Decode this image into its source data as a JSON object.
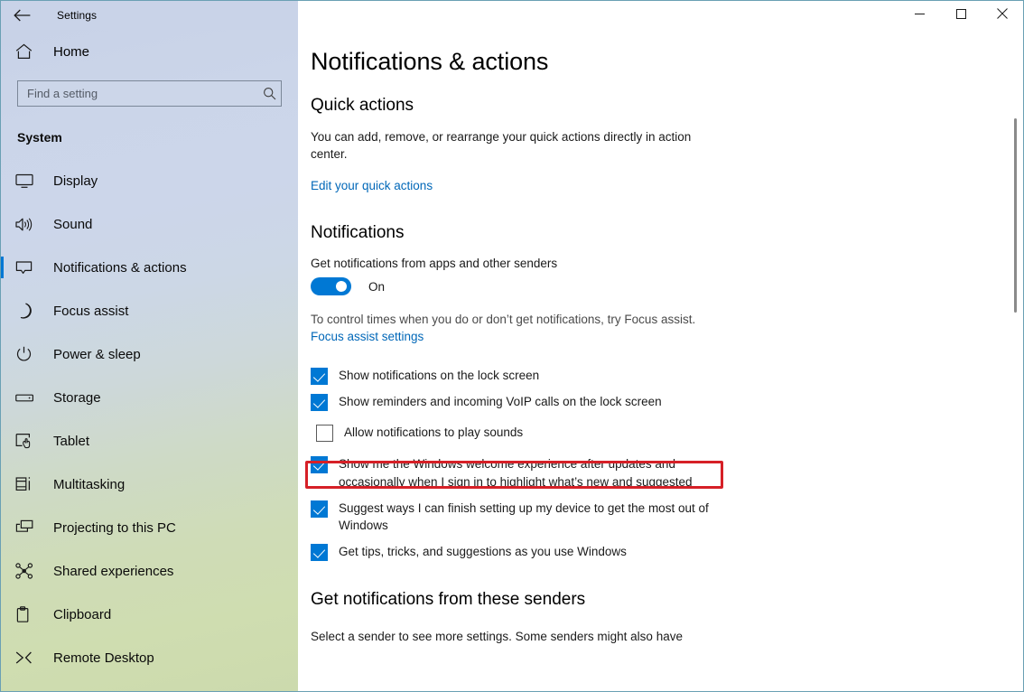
{
  "window": {
    "title": "Settings",
    "back_icon": "back-arrow-icon",
    "minimize_label": "─",
    "maximize_label": "☐",
    "close_label": "✕"
  },
  "sidebar": {
    "home_label": "Home",
    "home_icon": "home-icon",
    "search": {
      "placeholder": "Find a setting",
      "value": "",
      "icon": "search-icon"
    },
    "section_title": "System",
    "active_index": 2,
    "items": [
      {
        "label": "Display",
        "icon": "monitor-icon"
      },
      {
        "label": "Sound",
        "icon": "speaker-icon"
      },
      {
        "label": "Notifications & actions",
        "icon": "notification-bubble-icon"
      },
      {
        "label": "Focus assist",
        "icon": "moon-icon"
      },
      {
        "label": "Power & sleep",
        "icon": "power-icon"
      },
      {
        "label": "Storage",
        "icon": "drive-icon"
      },
      {
        "label": "Tablet",
        "icon": "tablet-hand-icon"
      },
      {
        "label": "Multitasking",
        "icon": "multitasking-icon"
      },
      {
        "label": "Projecting to this PC",
        "icon": "projecting-icon"
      },
      {
        "label": "Shared experiences",
        "icon": "share-nodes-icon"
      },
      {
        "label": "Clipboard",
        "icon": "clipboard-icon"
      },
      {
        "label": "Remote Desktop",
        "icon": "remote-desktop-icon"
      }
    ]
  },
  "main": {
    "page_title": "Notifications & actions",
    "quick_actions": {
      "heading": "Quick actions",
      "description": "You can add, remove, or rearrange your quick actions directly in action center.",
      "link": "Edit your quick actions"
    },
    "notifications": {
      "heading": "Notifications",
      "toggle_label": "Get notifications from apps and other senders",
      "toggle_state": "On",
      "toggle_on": true,
      "focus_note": "To control times when you do or don’t get notifications, try Focus assist.",
      "focus_link": "Focus assist settings",
      "checkboxes": [
        {
          "label": "Show notifications on the lock screen",
          "checked": true,
          "highlighted": false
        },
        {
          "label": "Show reminders and incoming VoIP calls on the lock screen",
          "checked": true,
          "highlighted": false
        },
        {
          "label": "Allow notifications to play sounds",
          "checked": false,
          "highlighted": true
        },
        {
          "label": "Show me the Windows welcome experience after updates and occasionally when I sign in to highlight what’s new and suggested",
          "checked": true,
          "highlighted": false
        },
        {
          "label": "Suggest ways I can finish setting up my device to get the most out of Windows",
          "checked": true,
          "highlighted": false
        },
        {
          "label": "Get tips, tricks, and suggestions as you use Windows",
          "checked": true,
          "highlighted": false
        }
      ]
    },
    "senders": {
      "heading": "Get notifications from these senders",
      "description": "Select a sender to see more settings. Some senders might also have"
    }
  },
  "colors": {
    "accent": "#0078d4",
    "link": "#0067b8",
    "highlight_box": "#d62027",
    "sidebar_top": "#c8d2e7",
    "sidebar_bottom": "#ccdaad"
  }
}
